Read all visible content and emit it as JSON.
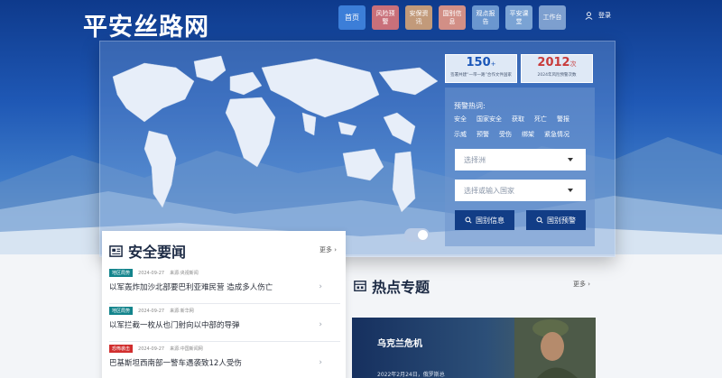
{
  "header": {
    "logo": "平安丝路网",
    "nav": [
      {
        "label": "首页",
        "color": "#3c7ed8"
      },
      {
        "label": "风险预警",
        "color": "#c9707a"
      },
      {
        "label": "安保资讯",
        "color": "#c29a7a"
      },
      {
        "label": "国别信息",
        "color": "#d28f86"
      },
      {
        "label": "观点报告",
        "color": "#6b97cf"
      },
      {
        "label": "平安课堂",
        "color": "#7aa3d4"
      },
      {
        "label": "工作台",
        "color": "#7d9fcf"
      }
    ],
    "login": "登录"
  },
  "stats": [
    {
      "number": "150",
      "suffix": "+",
      "caption": "签署共建“一带一路”合作文件国家",
      "color": "#1a56b8"
    },
    {
      "number": "2012",
      "suffix": "次",
      "caption": "2024年风险预警次数",
      "color": "#c83b3b"
    }
  ],
  "search": {
    "hot_title": "预警热词:",
    "hot_tags": [
      [
        "安全",
        "国家安全",
        "获取",
        "死亡",
        "警报"
      ],
      [
        "示威",
        "预警",
        "受伤",
        "绑架",
        "紧急情况"
      ]
    ],
    "continent_placeholder": "选择洲",
    "country_placeholder": "选择或输入国家",
    "btn_country_info": "国别信息",
    "btn_country_warning": "国别预警"
  },
  "news": {
    "title": "安全要闻",
    "more": "更多",
    "items": [
      {
        "badge": "地区局势",
        "badge_color": "#13848c",
        "date": "2024-09-27",
        "source": "来源:央视新闻",
        "title": "以军轰炸加沙北部要巴利亚难民营 造成多人伤亡"
      },
      {
        "badge": "地区局势",
        "badge_color": "#13848c",
        "date": "2024-09-27",
        "source": "来源:新华网",
        "title": "以军拦截一枚从也门射向以中部的导弹"
      },
      {
        "badge": "恐怖袭击",
        "badge_color": "#d12e2e",
        "date": "2024-09-27",
        "source": "来源:中国新闻网",
        "title": "巴基斯坦西南部一警车遇袭致12人受伤"
      }
    ]
  },
  "hot_topics": {
    "title": "热点专题",
    "more": "更多",
    "card_title": "乌克兰危机",
    "card_date": "2022年2月24日，俄罗斯总"
  }
}
